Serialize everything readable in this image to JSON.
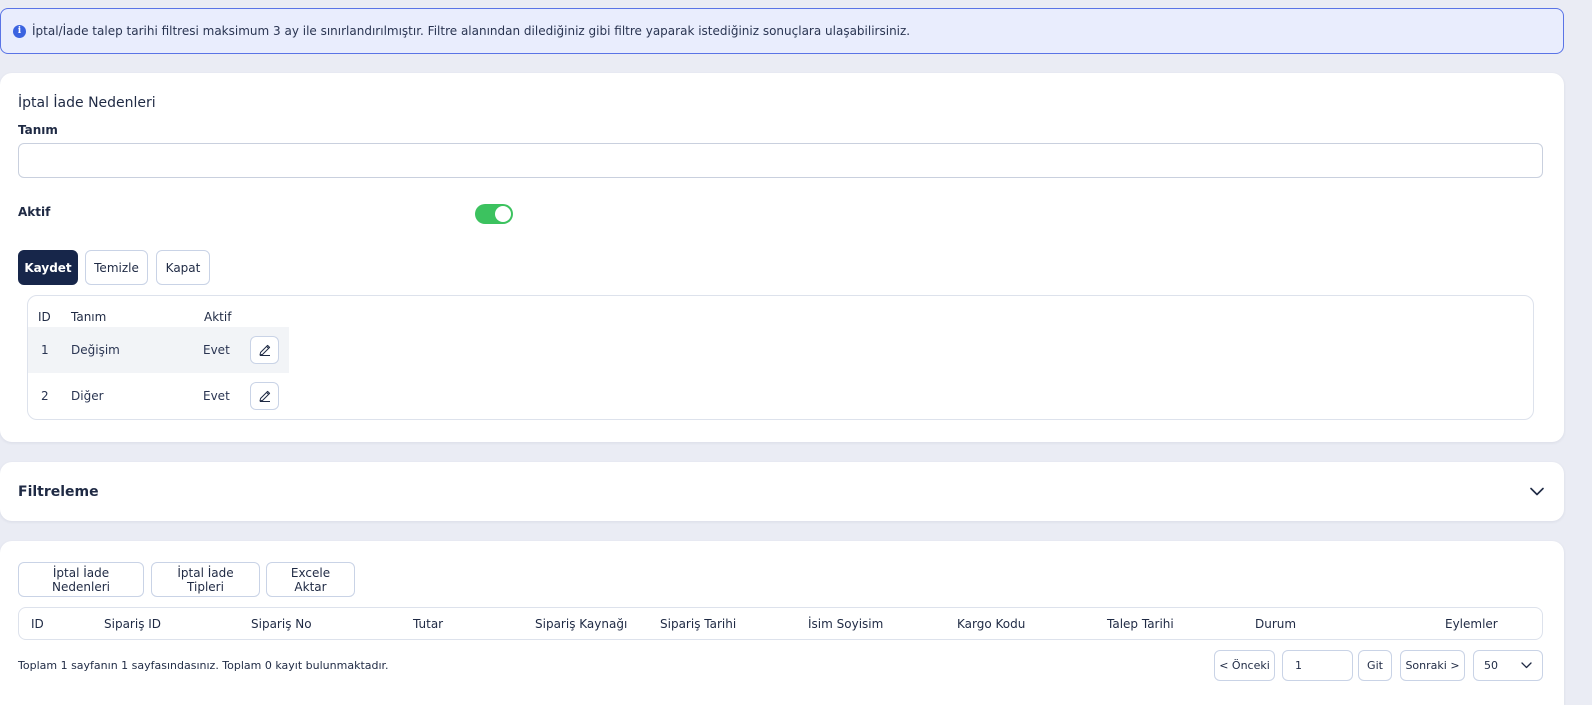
{
  "alert": {
    "text": "İptal/İade talep tarihi filtresi maksimum 3 ay ile sınırlandırılmıştır. Filtre alanından dilediğiniz gibi filtre yaparak istediğiniz sonuçlara ulaşabilirsiniz."
  },
  "form": {
    "title": "İptal İade Nedenleri",
    "definition_label": "Tanım",
    "definition_value": "",
    "active_label": "Aktif",
    "active_on": true,
    "save_label": "Kaydet",
    "clear_label": "Temizle",
    "close_label": "Kapat"
  },
  "reasons_table": {
    "headers": [
      "ID",
      "Tanım",
      "Aktif"
    ],
    "rows": [
      {
        "id": "1",
        "name": "Değişim",
        "active": "Evet"
      },
      {
        "id": "2",
        "name": "Diğer",
        "active": "Evet"
      }
    ]
  },
  "filter": {
    "title": "Filtreleme"
  },
  "grid": {
    "buttons": [
      "İptal İade Nedenleri",
      "İptal İade Tipleri",
      "Excele Aktar"
    ],
    "headers": [
      "ID",
      "Sipariş ID",
      "Sipariş No",
      "Tutar",
      "Sipariş Kaynağı",
      "Sipariş Tarihi",
      "İsim Soyisim",
      "Kargo Kodu",
      "Talep Tarihi",
      "Durum",
      "Eylemler"
    ],
    "summary": "Toplam 1 sayfanın 1 sayfasındasınız. Toplam 0 kayıt bulunmaktadır."
  },
  "pagination": {
    "prev_label": "< Önceki",
    "page_value": "1",
    "go_label": "Git",
    "next_label": "Sonraki >",
    "page_size": "50"
  },
  "colors": {
    "primary": "#17264a",
    "toggle_on": "#3cc25f",
    "alert_border": "#5a74e6"
  },
  "icons": [
    "info-icon",
    "pencil-icon",
    "chevron-down-icon"
  ]
}
